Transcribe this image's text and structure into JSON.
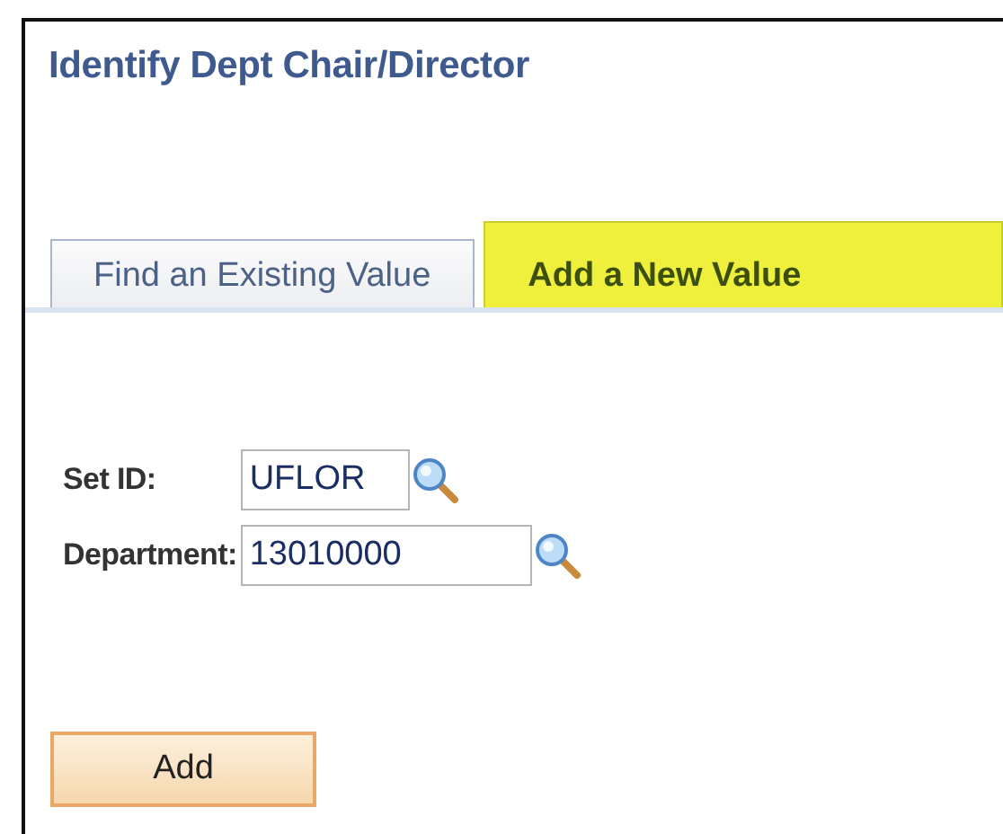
{
  "page": {
    "title": "Identify Dept Chair/Director"
  },
  "tabs": [
    {
      "label": "Find an Existing Value",
      "selected": false
    },
    {
      "label": "Add a New Value",
      "selected": true
    }
  ],
  "fields": [
    {
      "label": "Set ID:",
      "value": "UFLOR",
      "kind": "short"
    },
    {
      "label": "Department:",
      "value": "13010000",
      "kind": "long"
    }
  ],
  "buttons": [
    "Add"
  ]
}
